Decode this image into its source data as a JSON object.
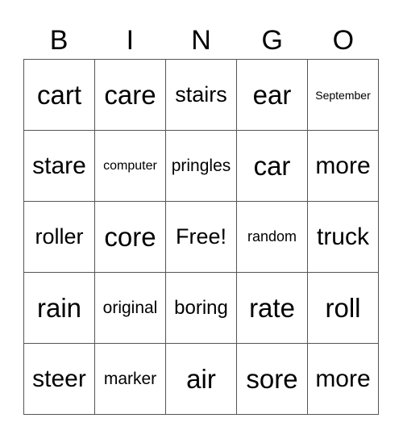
{
  "header": {
    "letters": [
      "B",
      "I",
      "N",
      "G",
      "O"
    ]
  },
  "board": {
    "rows": [
      [
        "cart",
        "care",
        "stairs",
        "ear",
        "September"
      ],
      [
        "stare",
        "computer",
        "pringles",
        "car",
        "more"
      ],
      [
        "roller",
        "core",
        "Free!",
        "random",
        "truck"
      ],
      [
        "rain",
        "original",
        "boring",
        "rate",
        "roll"
      ],
      [
        "steer",
        "marker",
        "air",
        "sore",
        "more"
      ]
    ]
  }
}
